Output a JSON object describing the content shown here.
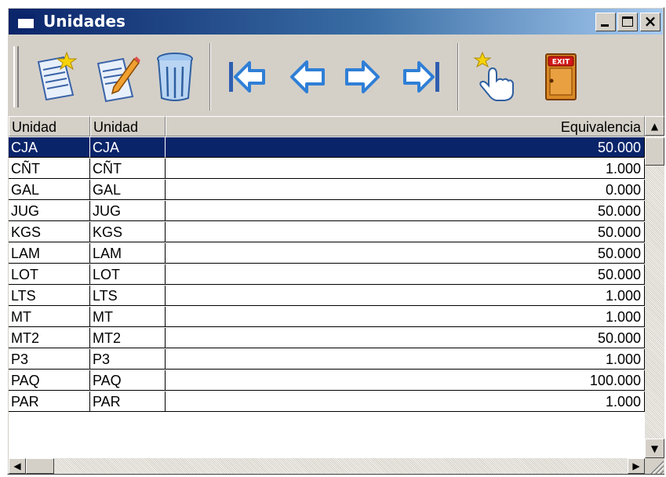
{
  "window": {
    "title": "Unidades"
  },
  "toolbar": {
    "buttons": [
      {
        "name": "new-record",
        "icon": "new-document-icon"
      },
      {
        "name": "edit-record",
        "icon": "edit-document-icon"
      },
      {
        "name": "delete-record",
        "icon": "trash-icon"
      },
      {
        "name": "first-record",
        "icon": "arrow-first-icon"
      },
      {
        "name": "previous-record",
        "icon": "arrow-left-icon"
      },
      {
        "name": "next-record",
        "icon": "arrow-right-icon"
      },
      {
        "name": "last-record",
        "icon": "arrow-last-icon"
      },
      {
        "name": "select",
        "icon": "hand-pointer-icon"
      },
      {
        "name": "exit",
        "icon": "exit-door-icon",
        "label": "EXIT"
      }
    ]
  },
  "grid": {
    "columns": [
      "Unidad",
      "Unidad",
      "Equivalencia"
    ],
    "selected_row": 0,
    "rows": [
      [
        "CJA",
        "CJA",
        "50.000"
      ],
      [
        "CÑT",
        "CÑT",
        "1.000"
      ],
      [
        "GAL",
        "GAL",
        "0.000"
      ],
      [
        "JUG",
        "JUG",
        "50.000"
      ],
      [
        "KGS",
        "KGS",
        "50.000"
      ],
      [
        "LAM",
        "LAM",
        "50.000"
      ],
      [
        "LOT",
        "LOT",
        "50.000"
      ],
      [
        "LTS",
        "LTS",
        "1.000"
      ],
      [
        "MT",
        "MT",
        "1.000"
      ],
      [
        "MT2",
        "MT2",
        "50.000"
      ],
      [
        "P3",
        "P3",
        "1.000"
      ],
      [
        "PAQ",
        "PAQ",
        "100.000"
      ],
      [
        "PAR",
        "PAR",
        "1.000"
      ]
    ]
  },
  "colors": {
    "titlebar": "#0a246a",
    "selection": "#0a246a",
    "face": "#d4d0c8",
    "arrow": "#3b82d6"
  }
}
